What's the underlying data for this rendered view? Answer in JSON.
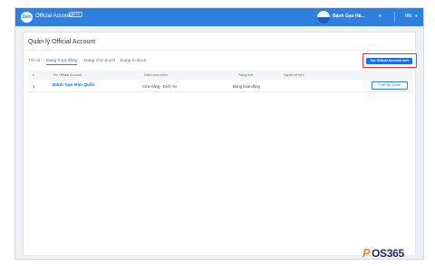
{
  "header": {
    "logo_text": "Zalo",
    "app_title": "Official Account",
    "beta_badge": "BETA",
    "account_name": "Bánh Gạo Hà...",
    "language": "VN",
    "brand_color": "#2f7fe0"
  },
  "page": {
    "title": "Quản lý Official Account",
    "create_button": "Tạo Official Account mới",
    "tabs": [
      {
        "label": "Tất cả",
        "active": false
      },
      {
        "label": "Đang hoạt động",
        "active": true
      },
      {
        "label": "Đang chờ duyệt",
        "active": false
      },
      {
        "label": "Đang bị khoá",
        "active": false
      }
    ]
  },
  "table": {
    "columns": [
      "#",
      "Tên Official Account",
      "Danh mục chính",
      "Trạng thái",
      "Người sở hữu"
    ],
    "rows": [
      {
        "index": "1",
        "name": "Bánh Gạo Hàn Quốc",
        "category": "Cửa Hàng - Dịch Vụ",
        "status": "Đang hoạt động",
        "owner": "",
        "action": "Thiết lập Admin"
      }
    ]
  },
  "watermark": {
    "p": "P",
    "rest": "OS365"
  }
}
